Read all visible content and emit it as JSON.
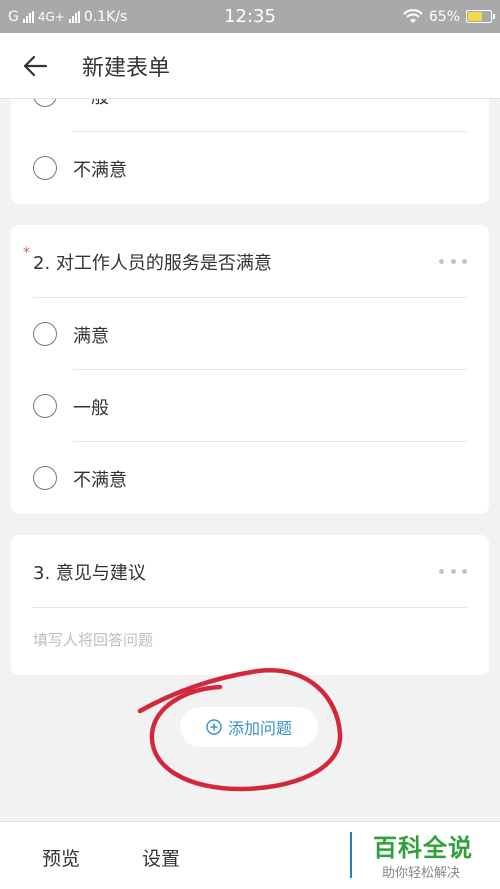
{
  "status_bar": {
    "carrier_left": "G",
    "network": "4G+",
    "speed": "0.1K/s",
    "time": "12:35",
    "battery_percent": "65%",
    "battery_level": 0.65
  },
  "header": {
    "title": "新建表单"
  },
  "question1_partial": {
    "options": [
      "一般",
      "不满意"
    ]
  },
  "question2": {
    "required_mark": "*",
    "title": "2. 对工作人员的服务是否满意",
    "options": [
      "满意",
      "一般",
      "不满意"
    ]
  },
  "question3": {
    "title": "3. 意见与建议",
    "placeholder": "填写人将回答问题"
  },
  "add_question": {
    "label": "添加问题"
  },
  "bottom_bar": {
    "preview": "预览",
    "settings": "设置"
  },
  "watermark": {
    "title": "百科全说",
    "subtitle": "助你轻松解决"
  },
  "colors": {
    "accent": "#3a8fc6",
    "required": "#e15a4d",
    "annotation": "#d3283a",
    "watermark_green": "#2ea13a"
  }
}
